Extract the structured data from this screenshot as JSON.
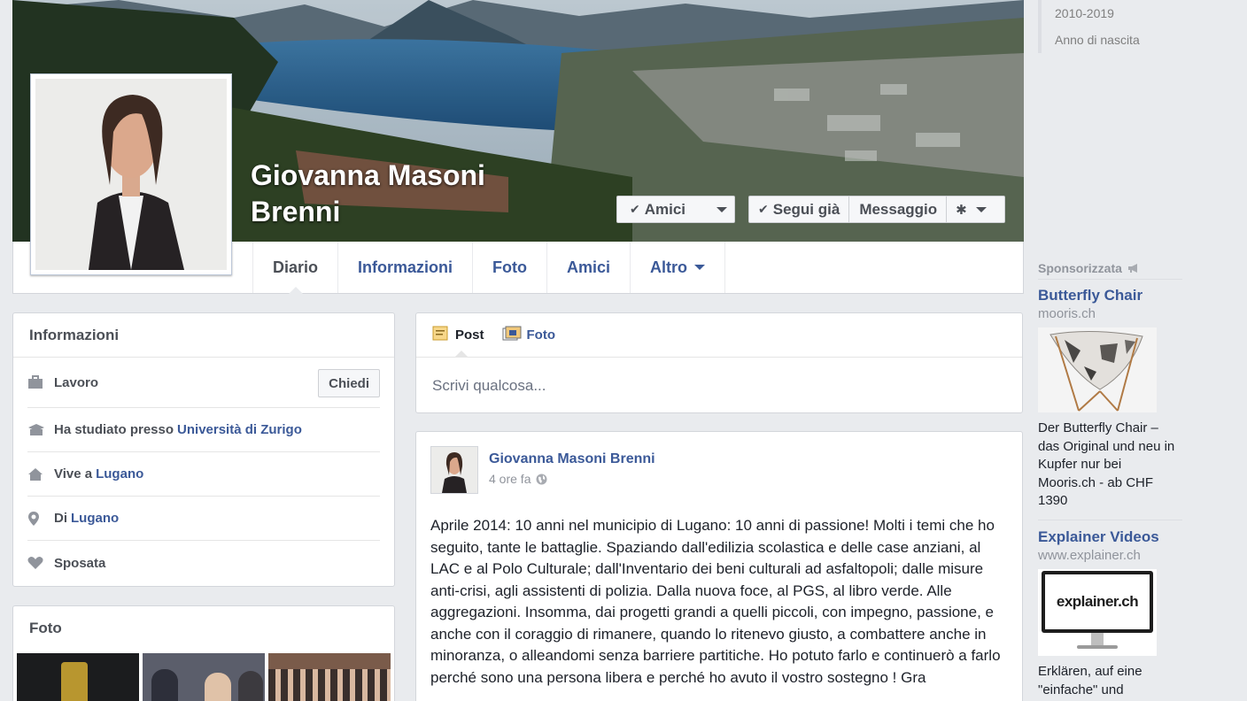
{
  "profile": {
    "name": "Giovanna Masoni Brenni"
  },
  "cover_actions": {
    "friends_label": "Amici",
    "follow_label": "Segui già",
    "message_label": "Messaggio"
  },
  "tabs": [
    {
      "label": "Diario"
    },
    {
      "label": "Informazioni"
    },
    {
      "label": "Foto"
    },
    {
      "label": "Amici"
    },
    {
      "label": "Altro"
    }
  ],
  "info_box": {
    "title": "Informazioni",
    "rows": [
      {
        "text": "Lavoro",
        "link": "",
        "icon": "briefcase-icon"
      },
      {
        "text": "Ha studiato presso",
        "link": "Università di Zurigo",
        "icon": "graduation-icon"
      },
      {
        "text": "Vive a",
        "link": "Lugano",
        "icon": "home-icon"
      },
      {
        "text": "Di",
        "link": "Lugano",
        "icon": "location-pin-icon"
      },
      {
        "text": "Sposata",
        "link": "",
        "icon": "heart-icon"
      }
    ],
    "ask_label": "Chiedi"
  },
  "photos_box": {
    "title": "Foto"
  },
  "composer": {
    "post_label": "Post",
    "photo_label": "Foto",
    "placeholder": "Scrivi qualcosa..."
  },
  "post": {
    "author": "Giovanna Masoni Brenni",
    "time": "4 ore fa",
    "text": "Aprile 2014: 10 anni nel municipio di Lugano: 10 anni di passione! Molti i temi che ho seguito, tante le battaglie. Spaziando dall'edilizia scolastica e delle case anziani, al LAC e al Polo Culturale; dall'Inventario dei beni culturali ad asfaltopoli; dalle misure anti-crisi, agli assistenti di polizia. Dalla nuova foce, al PGS, al libro verde. Alle aggregazioni. Insomma, dai progetti grandi a quelli piccoli, con impegno, passione, e anche con il coraggio di rimanere, quando lo ritenevo giusto, a combattere anche in minoranza, o alleandomi senza barriere partitiche. Ho potuto farlo e continuerò a farlo perché sono una persona libera e perché ho avuto il vostro sostegno ! Gra"
  },
  "sidebar": {
    "filters": [
      "2010-2019",
      "Anno di nascita"
    ],
    "sponsored_label": "Sponsorizzata",
    "ads": [
      {
        "title": "Butterfly Chair",
        "domain": "mooris.ch",
        "body": "Der Butterfly Chair – das Original und neu in Kupfer nur bei Mooris.ch - ab CHF 1390"
      },
      {
        "title": "Explainer Videos",
        "domain": "www.explainer.ch",
        "logo_text": "explainer.ch",
        "body": "Erklären, auf eine \"einfache\" und"
      }
    ]
  },
  "colors": {
    "link_blue": "#3b5998",
    "page_bg": "#e9ebee"
  }
}
